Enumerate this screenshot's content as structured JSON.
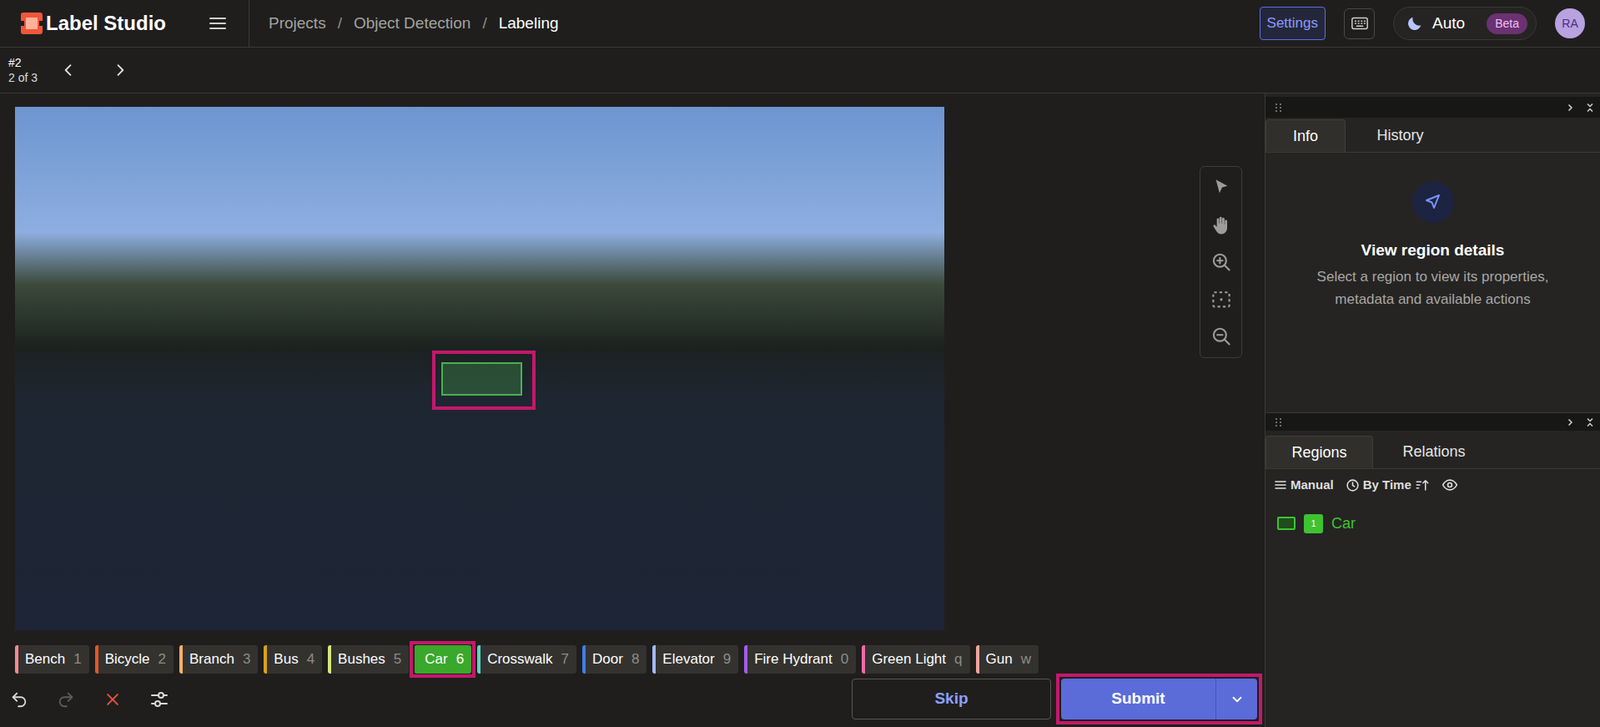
{
  "header": {
    "logo": "Label Studio",
    "breadcrumbs": [
      {
        "label": "Projects",
        "current": false
      },
      {
        "label": "Object Detection",
        "current": false
      },
      {
        "label": "Labeling",
        "current": true
      }
    ],
    "breadcrumb_separator": "/",
    "settings": "Settings",
    "theme": {
      "label": "Auto",
      "badge": "Beta"
    },
    "avatar": "RA"
  },
  "task": {
    "id": "#2",
    "position": "2 of 3"
  },
  "canvas": {
    "regions": [
      {
        "color": "#4caf50",
        "highlighted": true
      }
    ]
  },
  "labels": [
    {
      "name": "Bench",
      "hotkey": "1",
      "color": "#f58a94",
      "selected": false,
      "highlighted": false
    },
    {
      "name": "Bicycle",
      "hotkey": "2",
      "color": "#e2562a",
      "selected": false,
      "highlighted": false
    },
    {
      "name": "Branch",
      "hotkey": "3",
      "color": "#f5b067",
      "selected": false,
      "highlighted": false
    },
    {
      "name": "Bus",
      "hotkey": "4",
      "color": "#d9a21b",
      "selected": false,
      "highlighted": false
    },
    {
      "name": "Bushes",
      "hotkey": "5",
      "color": "#d4e57a",
      "selected": false,
      "highlighted": false
    },
    {
      "name": "Car",
      "hotkey": "6",
      "color": "#3aa82b",
      "selected": true,
      "highlighted": true
    },
    {
      "name": "Crosswalk",
      "hotkey": "7",
      "color": "#5fd3c3",
      "selected": false,
      "highlighted": false
    },
    {
      "name": "Door",
      "hotkey": "8",
      "color": "#3f7ee8",
      "selected": false,
      "highlighted": false
    },
    {
      "name": "Elevator",
      "hotkey": "9",
      "color": "#a3b9f3",
      "selected": false,
      "highlighted": false
    },
    {
      "name": "Fire Hydrant",
      "hotkey": "0",
      "color": "#a45ee8",
      "selected": false,
      "highlighted": false
    },
    {
      "name": "Green Light",
      "hotkey": "q",
      "color": "#f06ba8",
      "selected": false,
      "highlighted": false
    },
    {
      "name": "Gun",
      "hotkey": "w",
      "color": "#f5a39d",
      "selected": false,
      "highlighted": false
    }
  ],
  "actions": {
    "skip": "Skip",
    "submit": {
      "label": "Submit",
      "highlighted": true
    }
  },
  "info_panel": {
    "tabs": [
      {
        "label": "Info",
        "selected": true
      },
      {
        "label": "History",
        "selected": false
      }
    ],
    "title": "View region details",
    "description": "Select a region to view its properties, metadata and available actions"
  },
  "regions_panel": {
    "tabs": [
      {
        "label": "Regions",
        "selected": true
      },
      {
        "label": "Relations",
        "selected": false
      }
    ],
    "group": "Manual",
    "sort": "By Time",
    "regions": [
      {
        "index": "1",
        "label": "Car",
        "color": "#3ec232"
      }
    ]
  }
}
